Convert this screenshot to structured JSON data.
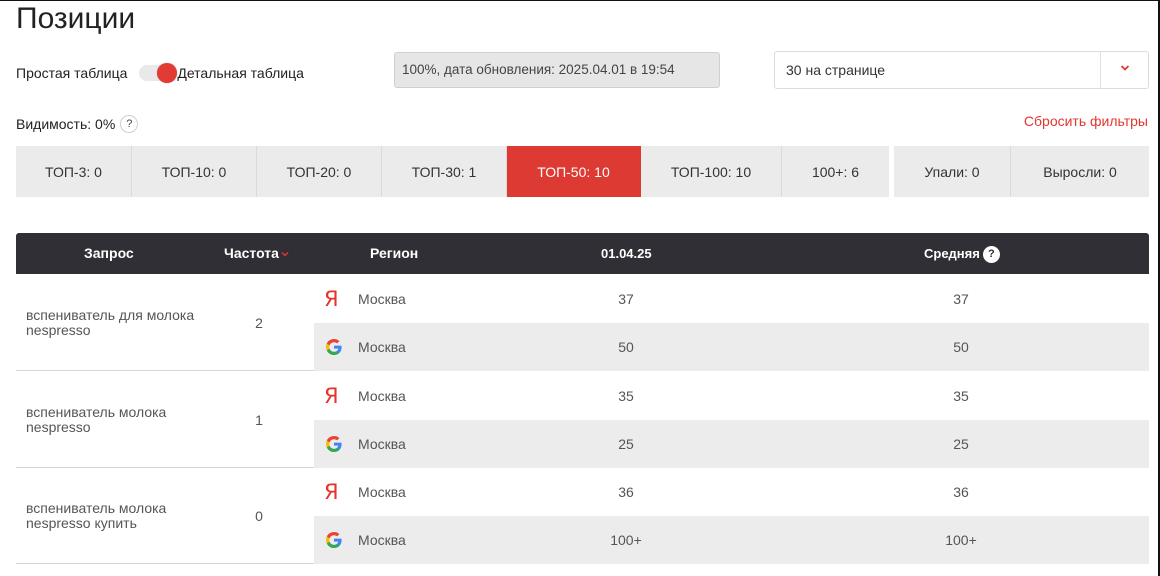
{
  "title": "Позиции",
  "view_toggle": {
    "left_label": "Простая таблица",
    "right_label": "Детальная таблица",
    "state": "detailed"
  },
  "status": "100%, дата обновления: 2025.04.01 в 19:54",
  "per_page": {
    "value": "30 на странице"
  },
  "visibility": {
    "label": "Видимость: 0%",
    "help": "?"
  },
  "reset_filters": "Сбросить фильтры",
  "filter_tabs": [
    {
      "label": "ТОП-3: 0",
      "active": false
    },
    {
      "label": "ТОП-10: 0",
      "active": false
    },
    {
      "label": "ТОП-20: 0",
      "active": false
    },
    {
      "label": "ТОП-30: 1",
      "active": false
    },
    {
      "label": "ТОП-50: 10",
      "active": true
    },
    {
      "label": "ТОП-100: 10",
      "active": false
    },
    {
      "label": "100+: 6",
      "active": false
    }
  ],
  "change_tabs": [
    {
      "label": "Упали: 0"
    },
    {
      "label": "Выросли: 0"
    }
  ],
  "table": {
    "columns": {
      "query": "Запрос",
      "frequency": "Частота",
      "region": "Регион",
      "date": "01.04.25",
      "average": "Средняя",
      "average_help": "?"
    },
    "rows": [
      {
        "query": "вспениватель для молока nespresso",
        "frequency": "2",
        "engines": [
          {
            "engine": "yandex",
            "icon": "Я",
            "region": "Москва",
            "date_value": "37",
            "average": "37"
          },
          {
            "engine": "google",
            "icon": "G",
            "region": "Москва",
            "date_value": "50",
            "average": "50"
          }
        ]
      },
      {
        "query": "вспениватель молока nespresso",
        "frequency": "1",
        "engines": [
          {
            "engine": "yandex",
            "icon": "Я",
            "region": "Москва",
            "date_value": "35",
            "average": "35"
          },
          {
            "engine": "google",
            "icon": "G",
            "region": "Москва",
            "date_value": "25",
            "average": "25"
          }
        ]
      },
      {
        "query": "вспениватель молока nespresso купить",
        "frequency": "0",
        "engines": [
          {
            "engine": "yandex",
            "icon": "Я",
            "region": "Москва",
            "date_value": "36",
            "average": "36"
          },
          {
            "engine": "google",
            "icon": "G",
            "region": "Москва",
            "date_value": "100+",
            "average": "100+"
          }
        ]
      }
    ]
  },
  "colors": {
    "accent": "#dc3a33",
    "header_bg": "#2f2f35",
    "tab_bg": "#ebebeb",
    "alt_row": "#ececec",
    "link": "#e2362f"
  }
}
